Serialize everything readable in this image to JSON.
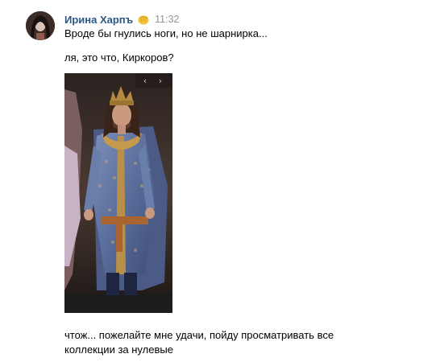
{
  "message": {
    "author": "Ирина Харпъ",
    "time": "11:32",
    "badge_icon": "punch-emoji-icon",
    "lines": [
      "Вроде бы гнулись ноги, но не шарнирка...",
      "ля, это что, Киркоров?",
      "чтож... пожелайте мне удачи, пойду просматривать все",
      "коллекции за нулевые"
    ],
    "attachment": {
      "icon": "photo-doll-image",
      "prev_glyph": "‹",
      "next_glyph": "›"
    }
  },
  "colors": {
    "author": "#2a5885",
    "timestamp": "#939393",
    "text": "#000000",
    "background": "#ffffff"
  }
}
